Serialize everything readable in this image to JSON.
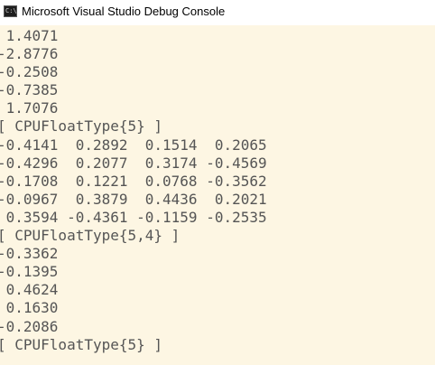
{
  "window": {
    "title": "Microsoft Visual Studio Debug Console",
    "icon": "console-app-icon",
    "icon_text": "C:\\",
    "console_background": "#fdf6e3",
    "text_color": "#555555"
  },
  "console": {
    "lines": [
      " 1.4071",
      "-2.8776",
      "-0.2508",
      "-0.7385",
      " 1.7076",
      "[ CPUFloatType{5} ]",
      "-0.4141  0.2892  0.1514  0.2065",
      "-0.4296  0.2077  0.3174 -0.4569",
      "-0.1708  0.1221  0.0768 -0.3562",
      "-0.0967  0.3879  0.4436  0.2021",
      " 0.3594 -0.4361 -0.1159 -0.2535",
      "[ CPUFloatType{5,4} ]",
      "-0.3362",
      "-0.1395",
      " 0.4624",
      " 0.1630",
      "-0.2086",
      "[ CPUFloatType{5} ]"
    ]
  }
}
